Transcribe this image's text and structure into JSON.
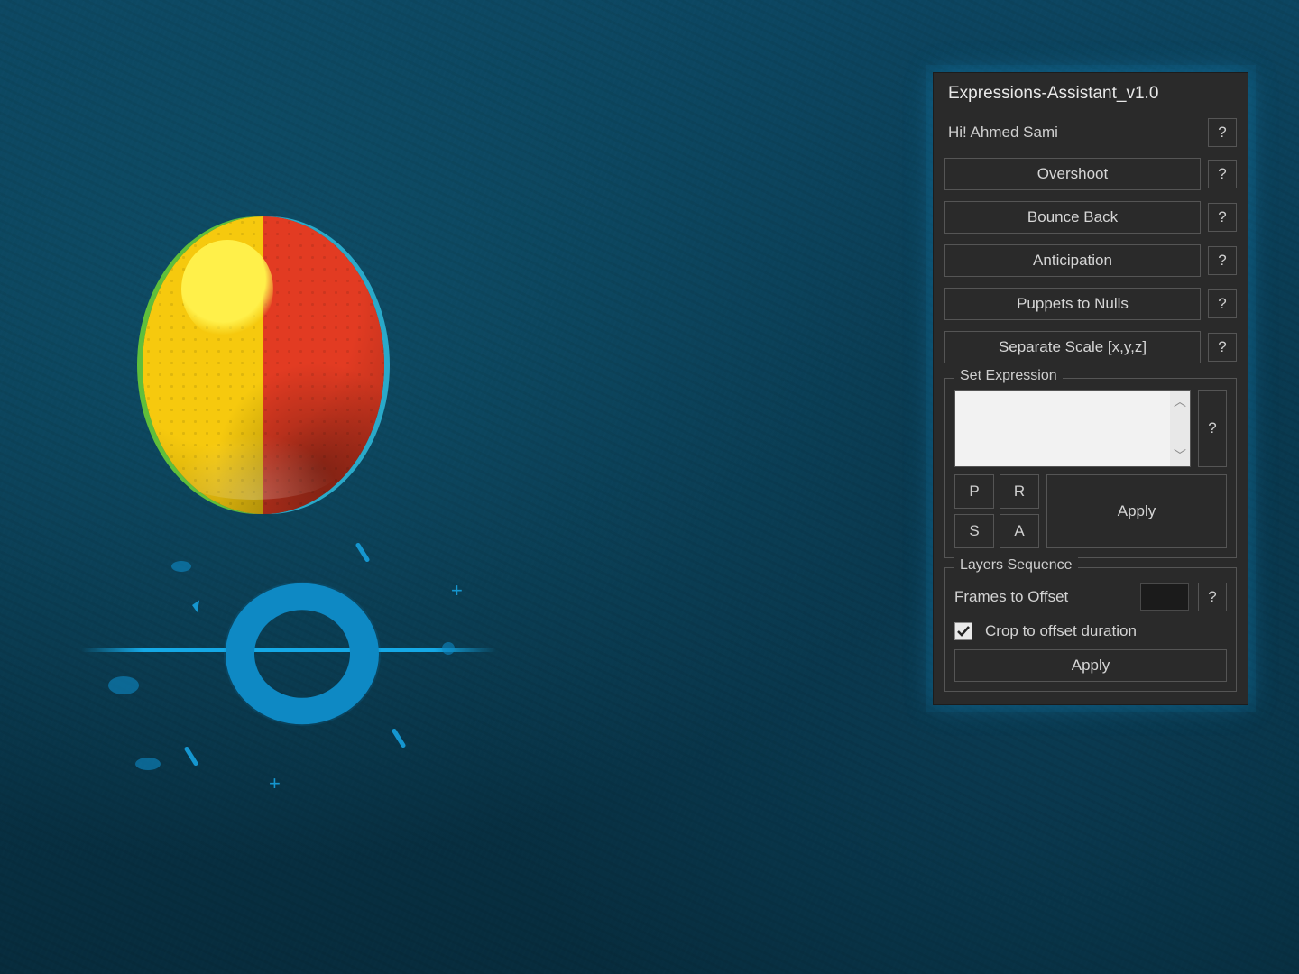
{
  "panel": {
    "title": "Expressions-Assistant_v1.0",
    "greeting": "Hi! Ahmed Sami",
    "help": "?",
    "actions": [
      "Overshoot",
      "Bounce Back",
      "Anticipation",
      "Puppets to Nulls",
      "Separate Scale [x,y,z]"
    ],
    "setExpression": {
      "legend": "Set Expression",
      "apply": "Apply",
      "props": {
        "p": "P",
        "r": "R",
        "s": "S",
        "a": "A"
      }
    },
    "layersSequence": {
      "legend": "Layers Sequence",
      "framesLabel": "Frames to Offset",
      "framesValue": "",
      "cropLabel": "Crop to offset duration",
      "cropChecked": true,
      "apply": "Apply"
    }
  }
}
